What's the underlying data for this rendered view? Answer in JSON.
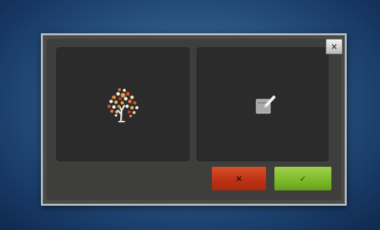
{
  "dialog": {
    "close_label": "×",
    "cancel_label": "×",
    "confirm_label": "✓"
  },
  "icons": {
    "left_preview": "embroidery-tree-design-icon",
    "right_preview": "edit-box-pencil-icon",
    "close": "close-icon",
    "cancel": "cancel-x-icon",
    "confirm": "checkmark-icon"
  },
  "colors": {
    "background": "#2a5583",
    "cancel_button": "#bf3315",
    "confirm_button": "#7fbb2c"
  }
}
